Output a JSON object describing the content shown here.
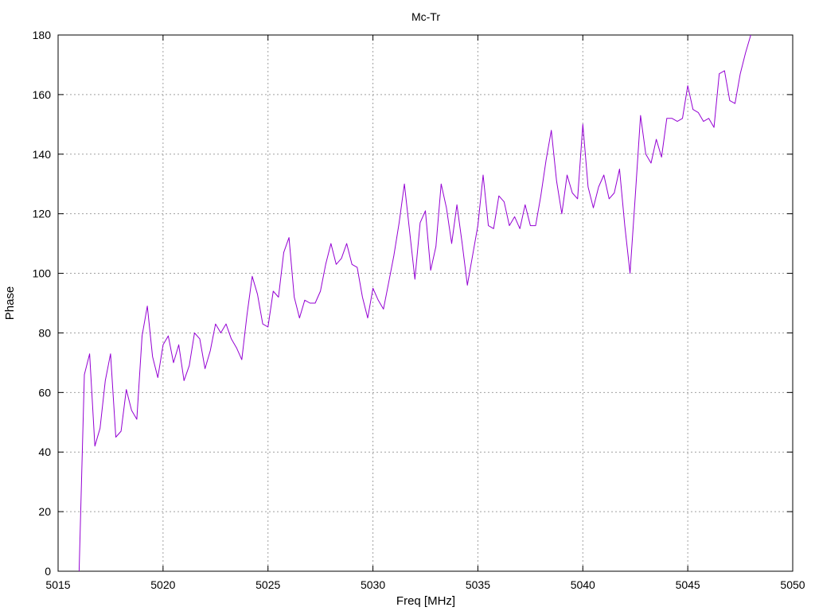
{
  "chart_data": {
    "type": "line",
    "title": "Mc-Tr",
    "xlabel": "Freq [MHz]",
    "ylabel": "Phase",
    "xlim": [
      5015,
      5050
    ],
    "ylim": [
      0,
      180
    ],
    "xticks": [
      5015,
      5020,
      5025,
      5030,
      5035,
      5040,
      5045,
      5050
    ],
    "yticks": [
      0,
      20,
      40,
      60,
      80,
      100,
      120,
      140,
      160,
      180
    ],
    "grid": true,
    "legend": "none",
    "series": [
      {
        "color": "#9400d3",
        "x": [
          5016.0,
          5016.25,
          5016.5,
          5016.75,
          5017.0,
          5017.25,
          5017.5,
          5017.75,
          5018.0,
          5018.25,
          5018.5,
          5018.75,
          5019.0,
          5019.25,
          5019.5,
          5019.75,
          5020.0,
          5020.25,
          5020.5,
          5020.75,
          5021.0,
          5021.25,
          5021.5,
          5021.75,
          5022.0,
          5022.25,
          5022.5,
          5022.75,
          5023.0,
          5023.25,
          5023.5,
          5023.75,
          5024.0,
          5024.25,
          5024.5,
          5024.75,
          5025.0,
          5025.25,
          5025.5,
          5025.75,
          5026.0,
          5026.25,
          5026.5,
          5026.75,
          5027.0,
          5027.25,
          5027.5,
          5027.75,
          5028.0,
          5028.25,
          5028.5,
          5028.75,
          5029.0,
          5029.25,
          5029.5,
          5029.75,
          5030.0,
          5030.25,
          5030.5,
          5030.75,
          5031.0,
          5031.25,
          5031.5,
          5031.75,
          5032.0,
          5032.25,
          5032.5,
          5032.75,
          5033.0,
          5033.25,
          5033.5,
          5033.75,
          5034.0,
          5034.25,
          5034.5,
          5034.75,
          5035.0,
          5035.25,
          5035.5,
          5035.75,
          5036.0,
          5036.25,
          5036.5,
          5036.75,
          5037.0,
          5037.25,
          5037.5,
          5037.75,
          5038.0,
          5038.25,
          5038.5,
          5038.75,
          5039.0,
          5039.25,
          5039.5,
          5039.75,
          5040.0,
          5040.25,
          5040.5,
          5040.75,
          5041.0,
          5041.25,
          5041.5,
          5041.75,
          5042.0,
          5042.25,
          5042.5,
          5042.75,
          5043.0,
          5043.25,
          5043.5,
          5043.75,
          5044.0,
          5044.25,
          5044.5,
          5044.75,
          5045.0,
          5045.25,
          5045.5,
          5045.75,
          5046.0,
          5046.25,
          5046.5,
          5046.75,
          5047.0,
          5047.25,
          5047.5,
          5047.75,
          5048.0
        ],
        "y": [
          0,
          66,
          73,
          42,
          48,
          64,
          73,
          45,
          47,
          61,
          54,
          51,
          79,
          89,
          72,
          65,
          76,
          79,
          70,
          76,
          64,
          69,
          80,
          78,
          68,
          74,
          83,
          80,
          83,
          78,
          75,
          71,
          86,
          99,
          93,
          83,
          82,
          94,
          92,
          107,
          112,
          92,
          85,
          91,
          90,
          90,
          94,
          103,
          110,
          103,
          105,
          110,
          103,
          102,
          92,
          85,
          95,
          91,
          88,
          97,
          106,
          117,
          130,
          114,
          98,
          117,
          121,
          101,
          109,
          130,
          122,
          110,
          123,
          110,
          96,
          106,
          116,
          133,
          116,
          115,
          126,
          124,
          116,
          119,
          115,
          123,
          116,
          116,
          126,
          138,
          148,
          131,
          120,
          133,
          127,
          125,
          150,
          129,
          122,
          129,
          133,
          125,
          127,
          135,
          116,
          100,
          126,
          153,
          140,
          137,
          145,
          139,
          152,
          152,
          151,
          152,
          163,
          155,
          154,
          151,
          152,
          149,
          167,
          168,
          158,
          157,
          167,
          174,
          180
        ]
      }
    ]
  }
}
